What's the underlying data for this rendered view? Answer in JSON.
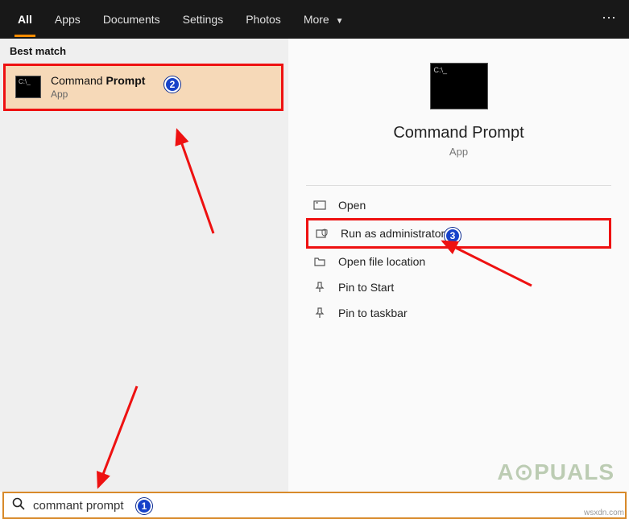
{
  "tabs": {
    "all": "All",
    "apps": "Apps",
    "documents": "Documents",
    "settings": "Settings",
    "photos": "Photos",
    "more": "More"
  },
  "left": {
    "header": "Best match",
    "result": {
      "title_pre": "Command ",
      "title_bold": "Prompt",
      "subtitle": "App"
    }
  },
  "right": {
    "title": "Command Prompt",
    "subtitle": "App",
    "actions": {
      "open": "Open",
      "run_admin": "Run as administrator",
      "open_loc": "Open file location",
      "pin_start": "Pin to Start",
      "pin_taskbar": "Pin to taskbar"
    }
  },
  "search": {
    "value": "commant prompt"
  },
  "annotations": {
    "b1": "1",
    "b2": "2",
    "b3": "3"
  },
  "watermark": "A⊙PUALS",
  "credit": "wsxdn.com"
}
